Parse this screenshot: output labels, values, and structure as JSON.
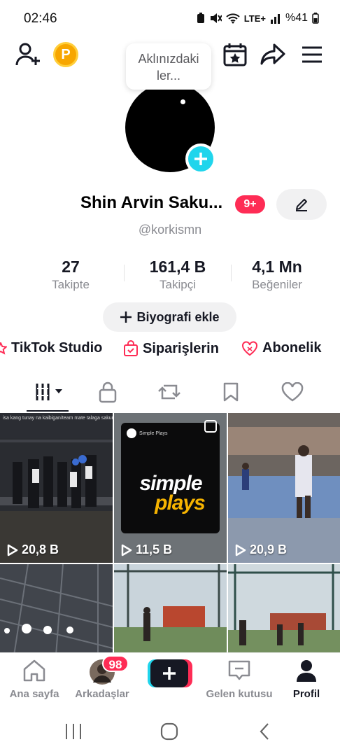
{
  "status_bar": {
    "time": "02:46",
    "battery": "%41",
    "network": "LTE+"
  },
  "top_bar": {
    "coin_letter": "P"
  },
  "bubble": {
    "text_line1": "Aklınızdaki",
    "text_line2": "ler..."
  },
  "profile": {
    "name": "Shin Arvin Saku...",
    "notifications_badge": "9+",
    "handle": "@korkismn"
  },
  "stats": [
    {
      "value": "27",
      "label": "Takipte"
    },
    {
      "value": "161,4 B",
      "label": "Takipçi"
    },
    {
      "value": "4,1 Mn",
      "label": "Beğeniler"
    }
  ],
  "bio_button": {
    "label": "Biyografi ekle"
  },
  "links": [
    {
      "label": "TikTok Studio",
      "icon": "star-icon"
    },
    {
      "label": "Siparişlerin",
      "icon": "bag-icon"
    },
    {
      "label": "Abonelik",
      "icon": "heart-outline-icon"
    }
  ],
  "tabs": [
    "videos-grid-icon",
    "lock-icon",
    "repost-icon",
    "bookmark-icon",
    "heart-icon"
  ],
  "videos": [
    {
      "views": "20,8 B",
      "caption": "isa kang tunay na kaibigan/team mate talaga sakuragi @"
    },
    {
      "views": "11,5 B",
      "logo_top": "simple",
      "logo_bottom": "plays",
      "channel": "Simple Plays"
    },
    {
      "views": "20,9 B"
    }
  ],
  "bottom_nav": {
    "home": "Ana sayfa",
    "friends": "Arkadaşlar",
    "friends_badge": "98",
    "inbox": "Gelen kutusu",
    "profile": "Profil"
  },
  "colors": {
    "accent_red": "#fe2c55",
    "accent_cyan": "#20d5ec",
    "coin": "#f7a600",
    "brand_yellow": "#f6b300"
  }
}
